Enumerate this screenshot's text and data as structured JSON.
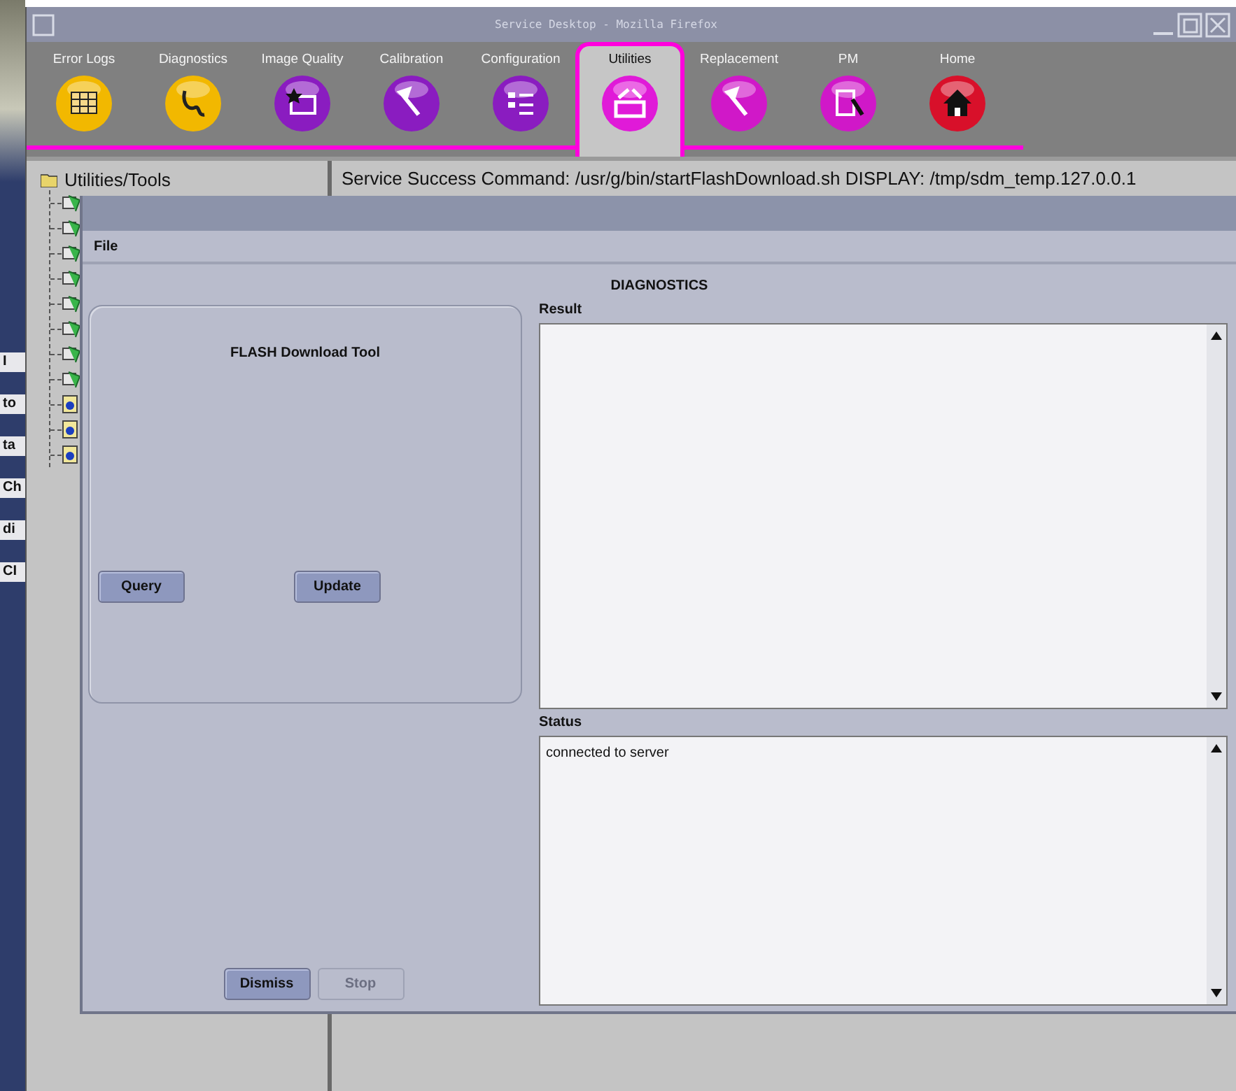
{
  "background_fragments": [
    "I",
    "to",
    "ta",
    "Ch",
    "di",
    "CI"
  ],
  "window": {
    "title": "Service Desktop - Mozilla Firefox"
  },
  "tabs": [
    {
      "label": "Error Logs",
      "color": "#f2b800",
      "selected": false
    },
    {
      "label": "Diagnostics",
      "color": "#f2b800",
      "selected": false
    },
    {
      "label": "Image Quality",
      "color": "#8a1cc0",
      "selected": false
    },
    {
      "label": "Calibration",
      "color": "#8a1cc0",
      "selected": false
    },
    {
      "label": "Configuration",
      "color": "#8a1cc0",
      "selected": false
    },
    {
      "label": "Utilities",
      "color": "#e01ad8",
      "selected": true
    },
    {
      "label": "Replacement",
      "color": "#d018c8",
      "selected": false
    },
    {
      "label": "PM",
      "color": "#d018c8",
      "selected": false
    },
    {
      "label": "Home",
      "color": "#d8102a",
      "selected": false
    }
  ],
  "tree": {
    "root": "Utilities/Tools",
    "children": [
      {
        "kind": "module"
      },
      {
        "kind": "module"
      },
      {
        "kind": "module"
      },
      {
        "kind": "module"
      },
      {
        "kind": "module"
      },
      {
        "kind": "module"
      },
      {
        "kind": "module"
      },
      {
        "kind": "module"
      },
      {
        "kind": "document"
      },
      {
        "kind": "document"
      },
      {
        "kind": "document"
      }
    ]
  },
  "command_line": "Service Success Command: /usr/g/bin/startFlashDownload.sh DISPLAY: /tmp/sdm_temp.127.0.0.1",
  "dialog": {
    "menu": [
      "File"
    ],
    "heading": "DIAGNOSTICS",
    "tool_group": {
      "title": "FLASH Download Tool",
      "buttons": [
        {
          "label": "Query",
          "disabled": false
        },
        {
          "label": "Update",
          "disabled": false
        }
      ]
    },
    "buttons": [
      {
        "label": "Dismiss",
        "disabled": false
      },
      {
        "label": "Stop",
        "disabled": true
      }
    ],
    "result": {
      "label": "Result"
    },
    "status": {
      "label": "Status",
      "text": "connected to server"
    }
  }
}
